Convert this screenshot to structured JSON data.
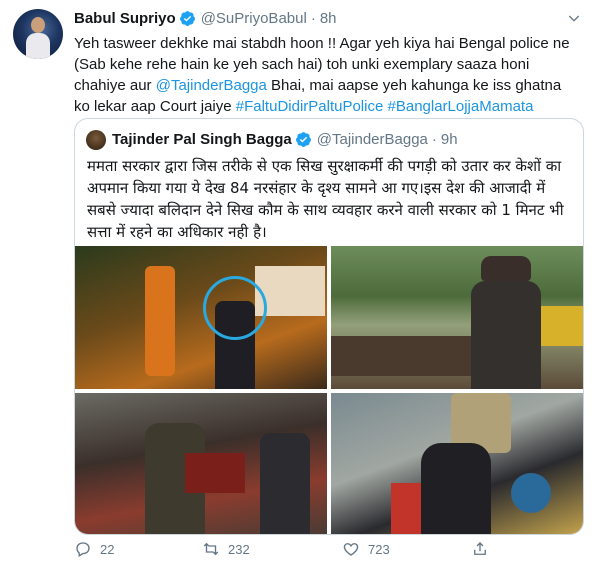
{
  "author": {
    "name": "Babul Supriyo",
    "handle": "@SuPriyoBabul",
    "separator": "·",
    "time": "8h"
  },
  "tweet": {
    "text_part1": "Yeh tasweer dekhke mai stabdh hoon !! Agar yeh kiya hai Bengal police ne (Sab kehe rehe hain ke yeh sach hai) toh unki exemplary saaza honi chahiye aur ",
    "mention": "@TajinderBagga",
    "text_part2": " Bhai, mai aapse yeh kahunga ke iss ghatna ko lekar aap Court jaiye ",
    "hashtag1": "#FaltuDidirPaltuPolice",
    "hashtag2": "#BanglarLojjaMamata"
  },
  "quoted": {
    "name": "Tajinder Pal Singh Bagga",
    "handle": "@TajinderBagga",
    "separator": "·",
    "time": "9h",
    "text": "ममता सरकार द्वारा जिस तरीके से एक सिख सुरक्षाकर्मी की पगड़ी को उतार कर केशों का अपमान किया गया ये देख 84 नरसंहार के दृश्य सामने आ गए।इस देश की आजादी में सबसे ज्यादा बलिदान देने सिख कौम के साथ व्यवहार करने वाली सरकार को 1 मिनट भी सत्ता में रहने का अधिकार नही है।"
  },
  "actions": {
    "replies": "22",
    "retweets": "232",
    "likes": "723"
  },
  "colors": {
    "link": "#1b95e0",
    "verified": "#1da1f2",
    "muted": "#657786",
    "border": "#ccd6dd"
  },
  "icons": [
    "verified-badge-icon",
    "chevron-down-icon",
    "reply-icon",
    "retweet-icon",
    "like-icon",
    "share-icon"
  ]
}
